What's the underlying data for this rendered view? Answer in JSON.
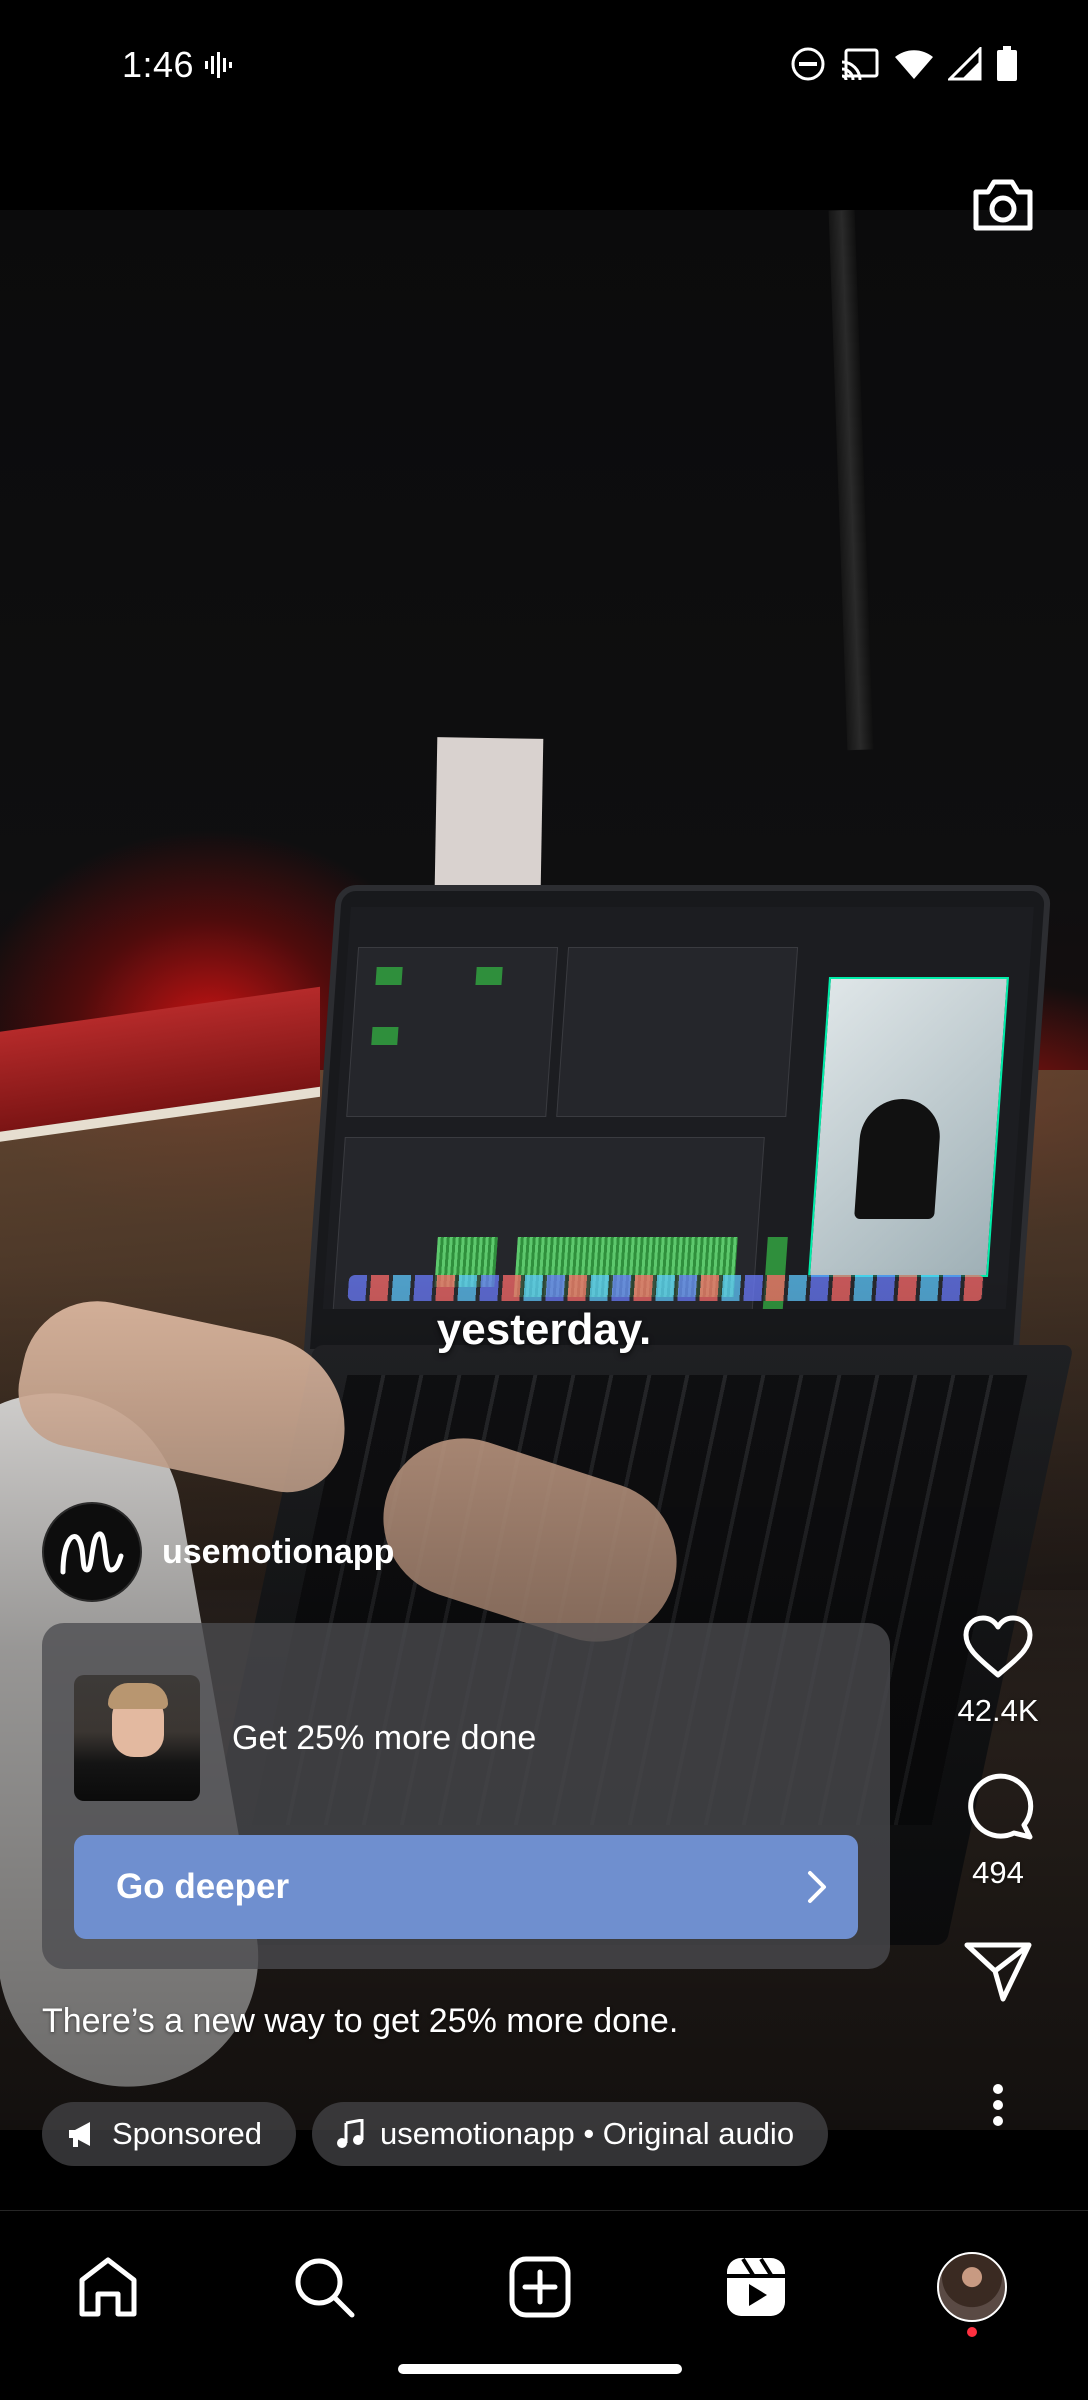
{
  "status_bar": {
    "time": "1:46",
    "icons": [
      "voice-icon",
      "do-not-disturb-icon",
      "cast-icon",
      "wifi-icon",
      "cell-signal-icon",
      "battery-icon"
    ]
  },
  "video": {
    "caption": "yesterday."
  },
  "author": {
    "username": "usemotionapp"
  },
  "ad": {
    "title": "Get 25% more done",
    "cta_label": "Go deeper"
  },
  "description": "There’s a new way to get 25% more done.",
  "actions": {
    "likes": "42.4K",
    "comments": "494"
  },
  "chips": {
    "sponsored": "Sponsored",
    "audio": "usemotionapp • Original audio"
  },
  "bottom_nav": {
    "items": [
      "home-icon",
      "search-icon",
      "create-icon",
      "reels-icon",
      "profile-avatar"
    ],
    "notification_color": "#ff3040"
  },
  "colors": {
    "cta": "#6f8fcf",
    "background": "#000000"
  }
}
